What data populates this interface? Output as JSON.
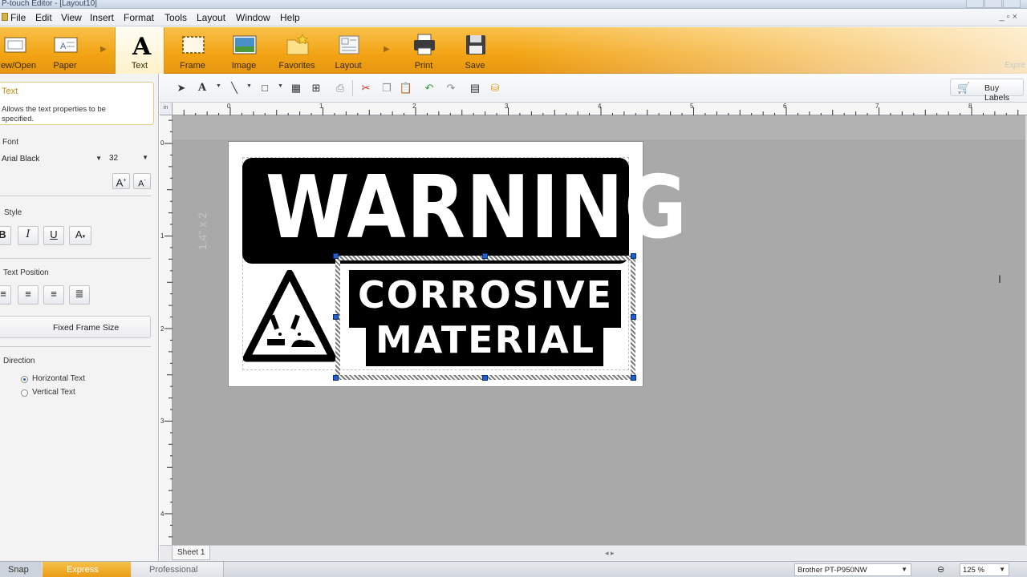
{
  "window": {
    "title": "P-touch Editor - [Layout10]"
  },
  "menu": [
    "File",
    "Edit",
    "View",
    "Insert",
    "Format",
    "Tools",
    "Layout",
    "Window",
    "Help"
  ],
  "ribbon": {
    "buttons": [
      {
        "label": "New/Open",
        "icon": "new-open-icon"
      },
      {
        "label": "Paper",
        "icon": "paper-icon"
      },
      {
        "label": "Text",
        "icon": "text-icon",
        "active": true
      },
      {
        "label": "Frame",
        "icon": "frame-icon"
      },
      {
        "label": "Image",
        "icon": "image-icon"
      },
      {
        "label": "Favorites",
        "icon": "favorites-icon"
      },
      {
        "label": "Layout",
        "icon": "layout-icon"
      },
      {
        "label": "Print",
        "icon": "print-icon"
      },
      {
        "label": "Save",
        "icon": "save-icon"
      }
    ],
    "mode_hint": "Expre"
  },
  "panel": {
    "tip_title": "Text",
    "tip_desc": "Allows the text properties to be specified.",
    "font_label": "Font",
    "font_value": "Arial Black",
    "size_value": "32",
    "style_label": "Style",
    "text_position_label": "Text Position",
    "fixed_frame_label": "Fixed Frame Size",
    "direction_label": "Direction",
    "horizontal_text": "Horizontal Text",
    "vertical_text": "Vertical Text",
    "direction_selected": "horizontal"
  },
  "toolbar": {
    "buy_labels": "Buy Labels"
  },
  "rulers": {
    "h_numbers": [
      "0",
      "1",
      "2",
      "3",
      "4",
      "5",
      "6",
      "7",
      "8"
    ],
    "v_numbers": [
      "0",
      "1",
      "2",
      "3",
      "4"
    ]
  },
  "label": {
    "warning": "WARNING",
    "line1": "CORROSIVE",
    "line2": "MATERIAL",
    "size_hint": "1.4\" x 2"
  },
  "sheet": {
    "tab": "Sheet 1"
  },
  "status": {
    "snap": "Snap",
    "express": "Express",
    "professional": "Professional",
    "printer": "Brother PT-P950NW",
    "zoom": "125 %"
  },
  "colors": {
    "ribbon_orange": "#f2a414",
    "canvas_gray": "#a9a9aa",
    "handle_blue": "#1f5fd1"
  }
}
